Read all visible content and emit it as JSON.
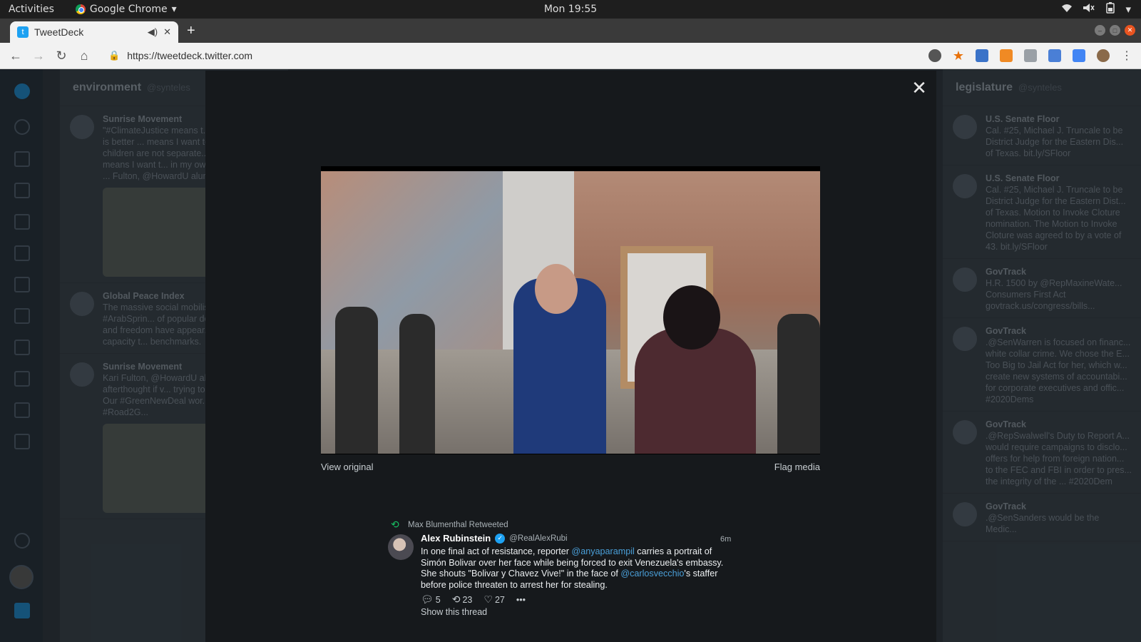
{
  "system_bar": {
    "activities": "Activities",
    "app_name": "Google Chrome",
    "clock": "Mon 19:55"
  },
  "browser": {
    "tab_title": "TweetDeck",
    "url": "https://tweetdeck.twitter.com"
  },
  "background_columns": {
    "left": {
      "title": "environment",
      "handle": "@synteles",
      "tweets": [
        {
          "name": "Sunrise Movement",
          "text": "\"#ClimateJustice means t... see a world that is better ... means I want to see a wo... children are not separate... families. It means I want t... in my own personal ways ... Fulton, @HowardU alum ... it is!"
        },
        {
          "name": "Global Peace Index",
          "text": "The massive social mobilis... following the #ArabSprin... of popular demands for b... and freedom have appear... beyond states' capacity t... benchmarks."
        },
        {
          "name": "Sunrise Movement",
          "text": "Kari Fulton, @HowardU al... is not an afterthought if v... trying to build collective l... Our #GreenNewDeal wor... anyone behind. #Road2G..."
        }
      ]
    },
    "right": {
      "title": "legislature",
      "handle": "@synteles",
      "tweets": [
        {
          "name": "U.S. Senate Floor",
          "text": "Cal. #25, Michael J. Truncale to be District Judge for the Eastern Dis... of Texas. bit.ly/SFloor"
        },
        {
          "name": "U.S. Senate Floor",
          "text": "Cal. #25, Michael J. Truncale to be District Judge for the Eastern Dist... of Texas. Motion to Invoke Cloture nomination. The Motion to Invoke Cloture was agreed to by a vote of 43. bit.ly/SFloor"
        },
        {
          "name": "GovTrack",
          "text": "H.R. 1500 by @RepMaxineWate... Consumers First Act govtrack.us/congress/bills..."
        },
        {
          "name": "GovTrack",
          "text": ".@SenWarren is focused on financ... white collar crime. We chose the E... Too Big to Jail Act for her, which w... create new systems of accountabi... for corporate executives and offic... #2020Dems"
        },
        {
          "name": "GovTrack",
          "text": ".@RepSwalwell's Duty to Report A... would require campaigns to disclo... offers for help from foreign nation... to the FEC and FBI in order to pres... the integrity of the ... #2020Dem"
        },
        {
          "name": "GovTrack",
          "text": ".@SenSanders would be the Medic..."
        }
      ]
    }
  },
  "modal": {
    "view_original": "View original",
    "flag_media": "Flag media",
    "retweeted_by": "Max Blumenthal Retweeted",
    "author_name": "Alex Rubinstein",
    "author_handle": "@RealAlexRubi",
    "timestamp": "6m",
    "text_part1": "In one final act of resistance, reporter ",
    "mention1": "@anyaparampil",
    "text_part2": " carries a portrait of Simón Bolivar over her face while being forced to exit Venezuela's embassy. She shouts \"Bolivar y Chavez Vive!\" in the face of ",
    "mention2": "@carlosvecchio",
    "text_part3": "'s staffer before police threaten to arrest her for stealing.",
    "reply_count": "5",
    "retweet_count": "23",
    "like_count": "27",
    "show_thread": "Show this thread"
  }
}
